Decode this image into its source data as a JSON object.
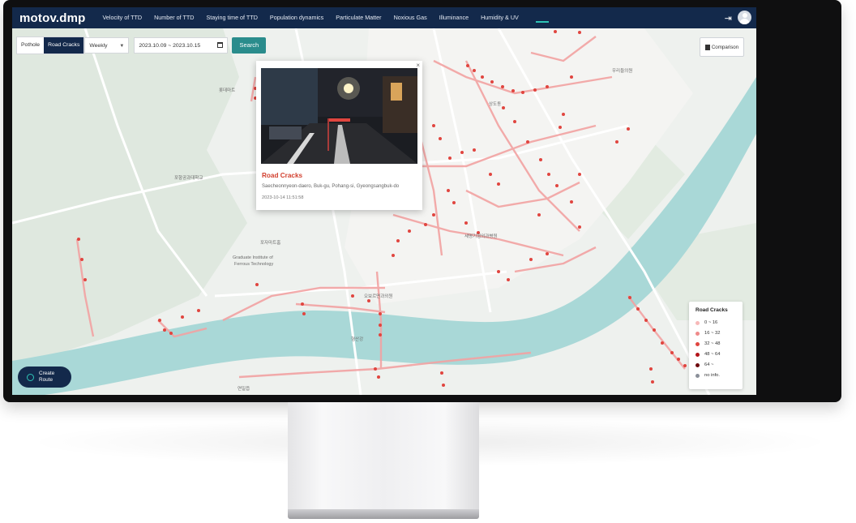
{
  "app": {
    "logo": "motov.dmp"
  },
  "nav": {
    "items": [
      {
        "label": "Velocity of TTD"
      },
      {
        "label": "Number of TTD"
      },
      {
        "label": "Staying time of TTD"
      },
      {
        "label": "Population dynamics"
      },
      {
        "label": "Particulate Matter"
      },
      {
        "label": "Noxious Gas"
      },
      {
        "label": "Illuminance"
      },
      {
        "label": "Humidity & UV"
      }
    ]
  },
  "filters": {
    "type_options": [
      "Pothole",
      "Road Cracks"
    ],
    "type_selected": "Road Cracks",
    "period": "Weekly",
    "date_range": "2023.10.09 ~ 2023.10.15",
    "search_label": "Search",
    "comparison_label": "Comparison"
  },
  "popup": {
    "title": "Road Cracks",
    "address": "Saecheonnyeon-daero, Buk-gu, Pohang-si, Gyeongsangbuk-do",
    "timestamp": "2023-10-14 11:51:58",
    "close_label": "×"
  },
  "legend": {
    "title": "Road Cracks",
    "rows": [
      {
        "label": "0 ~ 16",
        "color": "#f7b8b8"
      },
      {
        "label": "16 ~ 32",
        "color": "#ef8a8a"
      },
      {
        "label": "32 ~ 48",
        "color": "#e0453f"
      },
      {
        "label": "48 ~ 64",
        "color": "#b3141a"
      },
      {
        "label": "64 ~",
        "color": "#6e0a0e"
      },
      {
        "label": "no info.",
        "color": "#8a8f99"
      }
    ]
  },
  "create_route": {
    "line1": "Create",
    "line2": "Route"
  },
  "map_labels": [
    {
      "text": "포항공과대학교"
    },
    {
      "text": "Graduate Institute of"
    },
    {
      "text": "Ferrous Technology"
    },
    {
      "text": "포자마트홈"
    },
    {
      "text": "롯데마트"
    },
    {
      "text": "형산강"
    },
    {
      "text": "연일읍"
    },
    {
      "text": "우리들의원"
    },
    {
      "text": "오보르면과외원"
    },
    {
      "text": "세명기형외과병원"
    },
    {
      "text": "상도동"
    }
  ],
  "colors": {
    "nav_bg": "#13294b",
    "accent": "#2a8c8c",
    "crack": "#e0453f"
  }
}
